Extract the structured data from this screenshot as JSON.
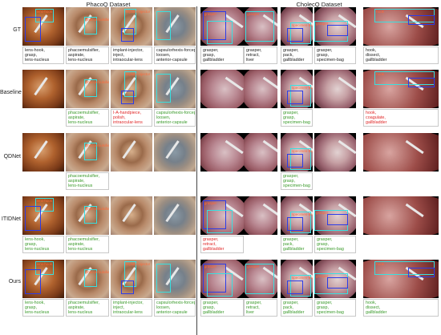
{
  "headers": {
    "phacoq": "PhacoQ Dataset",
    "cholecq": "CholecQ Dataset"
  },
  "rows": [
    "GT",
    "Baseline",
    "QDNet",
    "ITIDNet",
    "Ours"
  ],
  "captions": {
    "gt": {
      "p1": "lens-hook,\ngrasp,\nlens-nucleus",
      "p2": "phacoemulsifier,\naspirate,\nlens-nucleus",
      "p3": "implant-injector,\ninject,\nintraocular-lens",
      "p4": "capsulorhexis-forceps,\nloosen,\nanterior-capsule",
      "c1": "grasper,\ngrasp,\ngallbladder",
      "c2": "grasper,\nretract,\nliver",
      "c3": "grasper,\npack,\ngallbladder",
      "c4": "grasper,\ngrasp,\nspecimen-bag",
      "c5": "hook,\ndissect,\ngallbladder"
    },
    "baseline": {
      "p2": "phacoemulsifier,\naspirate,\nlens-nucleus",
      "p3": "I-A-handpiece,\npolish,\nintraocular-lens",
      "p4": "capsulorhexis-forceps,\nloosen,\nanterior-capsule",
      "c3": "grasper,\ngrasp,\nspecimen-bag",
      "c5": "hook,\ncoagulate,\ngallbladder"
    },
    "qdnet": {
      "p2": "phacoemulsifier,\naspirate,\nlens-nucleus",
      "c3": "grasper,\ngrasp,\nspecimen-bag"
    },
    "itidnet": {
      "p1": "lens-hook,\ngrasp,\nlens-nucleus",
      "p2": "phacoemulsifier,\naspirate,\nlens-nucleus",
      "c1": "grasper,\nretract,\ngallbladder",
      "c3": "grasper,\npack,\ngallbladder",
      "c4": "grasper,\ngrasp,\nspecimen-bag"
    },
    "ours": {
      "p1": "lens-hook,\ngrasp,\nlens-nucleus",
      "p2": "phacoemulsifier,\naspirate,\nlens-nucleus",
      "p3": "implant-injector,\ninject,\nintraocular-lens",
      "p4": "capsulorhexis-forceps,\nloosen,\nanterior-capsule",
      "c1": "grasper,\ngrasp,\ngallbladder",
      "c2": "grasper,\nretract,\nliver",
      "c3": "grasper,\npack,\ngallbladder",
      "c4": "grasper,\ngrasp,\nspecimen-bag",
      "c5": "hook,\ndissect,\ngallbladder"
    }
  },
  "box_labels": {
    "lens": "lens-hook",
    "phaco": "phacoemulsifier",
    "implant": "implant-injector",
    "grasper": "grasper",
    "bag": "specimen-bag",
    "hook": "hook"
  },
  "colors": {
    "gt_box": "#38e0e0",
    "pred_box": "#2c3ce8",
    "label_text": "#ff6a3a",
    "correct": "#3a9a2a",
    "wrong": "#e02828",
    "gt_text": "#222222"
  }
}
